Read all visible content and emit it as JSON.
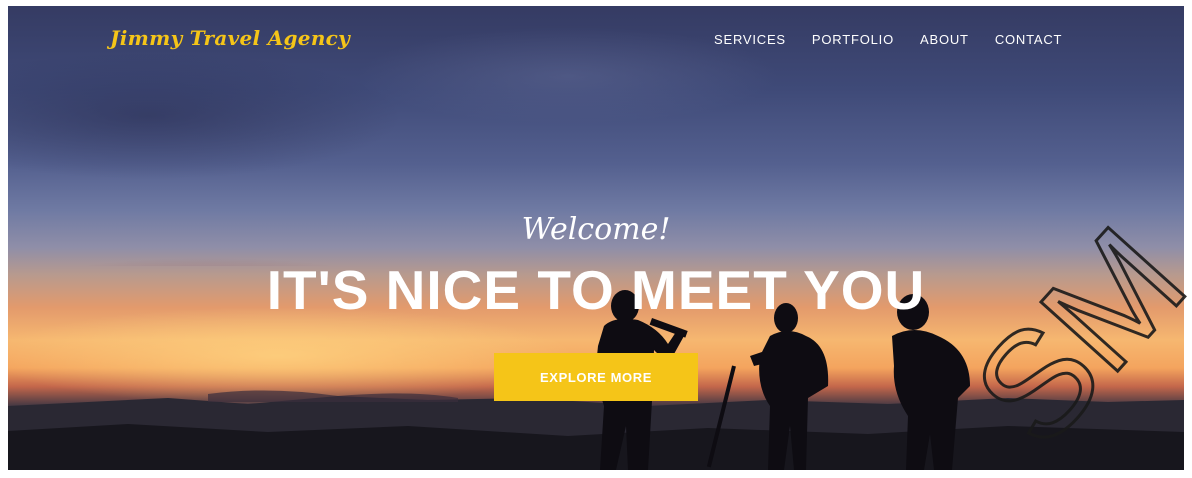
{
  "brand": {
    "name": "Jimmy Travel Agency",
    "color": "#f5c518"
  },
  "nav": {
    "items": [
      {
        "label": "SERVICES"
      },
      {
        "label": "PORTFOLIO"
      },
      {
        "label": "ABOUT"
      },
      {
        "label": "CONTACT"
      }
    ]
  },
  "hero": {
    "welcome": "Welcome!",
    "headline": "IT'S NICE TO MEET YOU",
    "cta_label": "EXPLORE MORE",
    "cta_color": "#f5c518"
  },
  "watermark": {
    "text": "SM"
  }
}
